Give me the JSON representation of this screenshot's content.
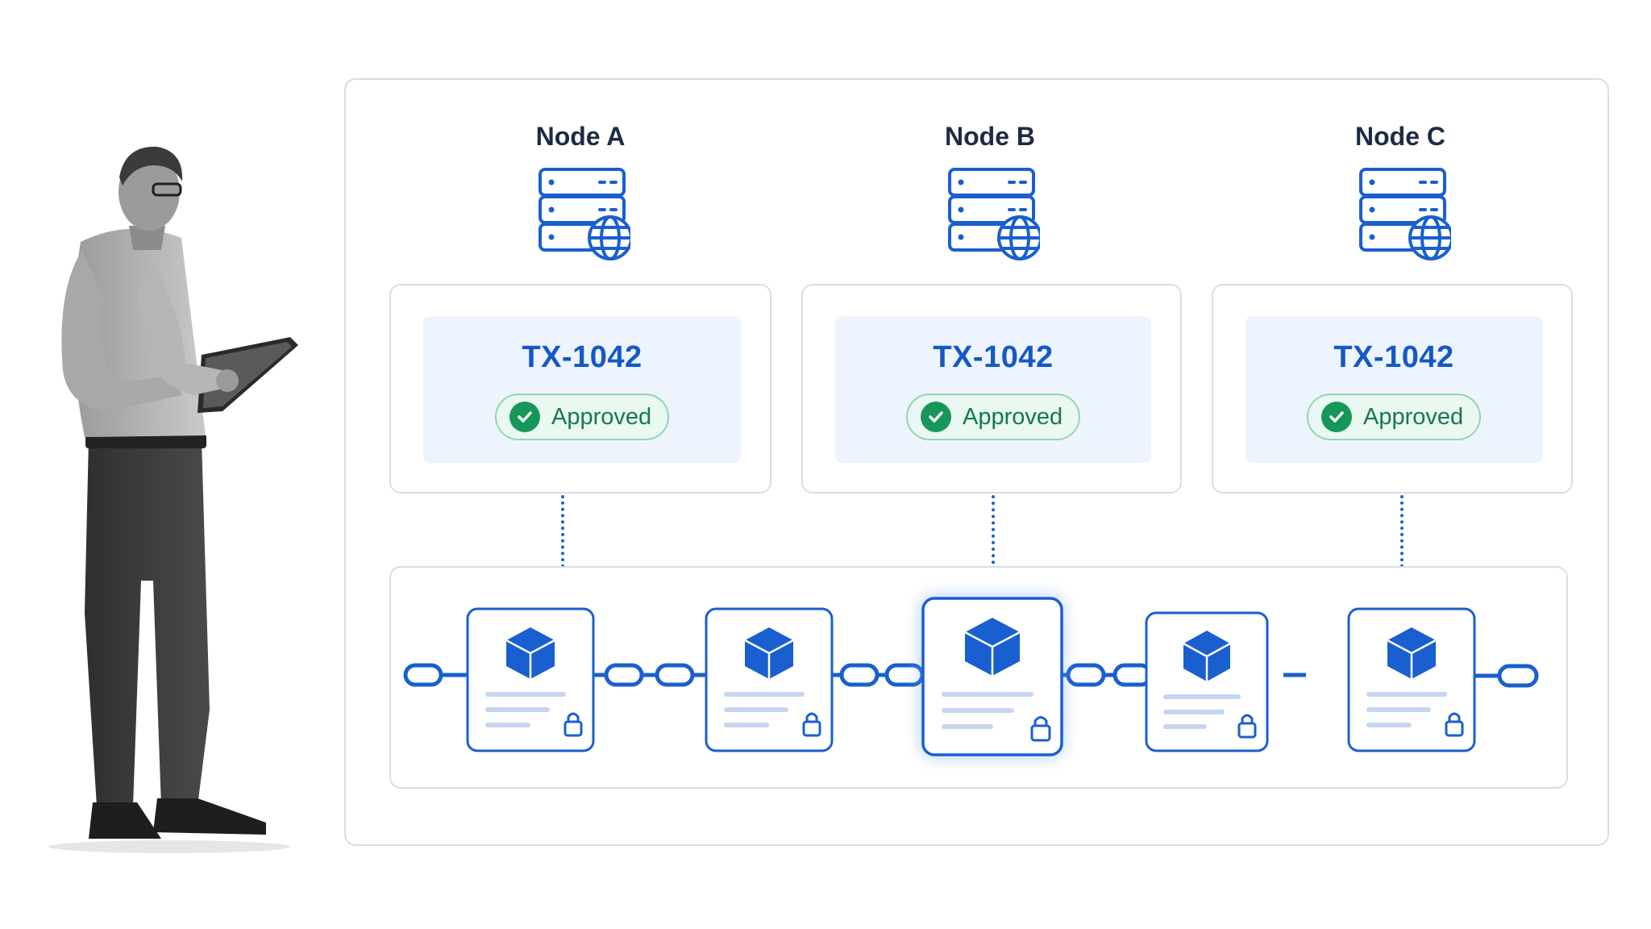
{
  "nodes": [
    {
      "title": "Node A",
      "tx_id": "TX-1042",
      "status": "Approved"
    },
    {
      "title": "Node B",
      "tx_id": "TX-1042",
      "status": "Approved"
    },
    {
      "title": "Node C",
      "tx_id": "TX-1042",
      "status": "Approved"
    }
  ],
  "chain": {
    "block_count": 5,
    "highlighted_block": 3
  },
  "colors": {
    "accent": "#1a5fd0",
    "approved_green": "#16975a",
    "title_dark": "#1c2b45"
  },
  "icons": [
    "server-globe-icon",
    "check-circle-icon",
    "cube-icon",
    "lock-icon",
    "chain-link-icon"
  ]
}
